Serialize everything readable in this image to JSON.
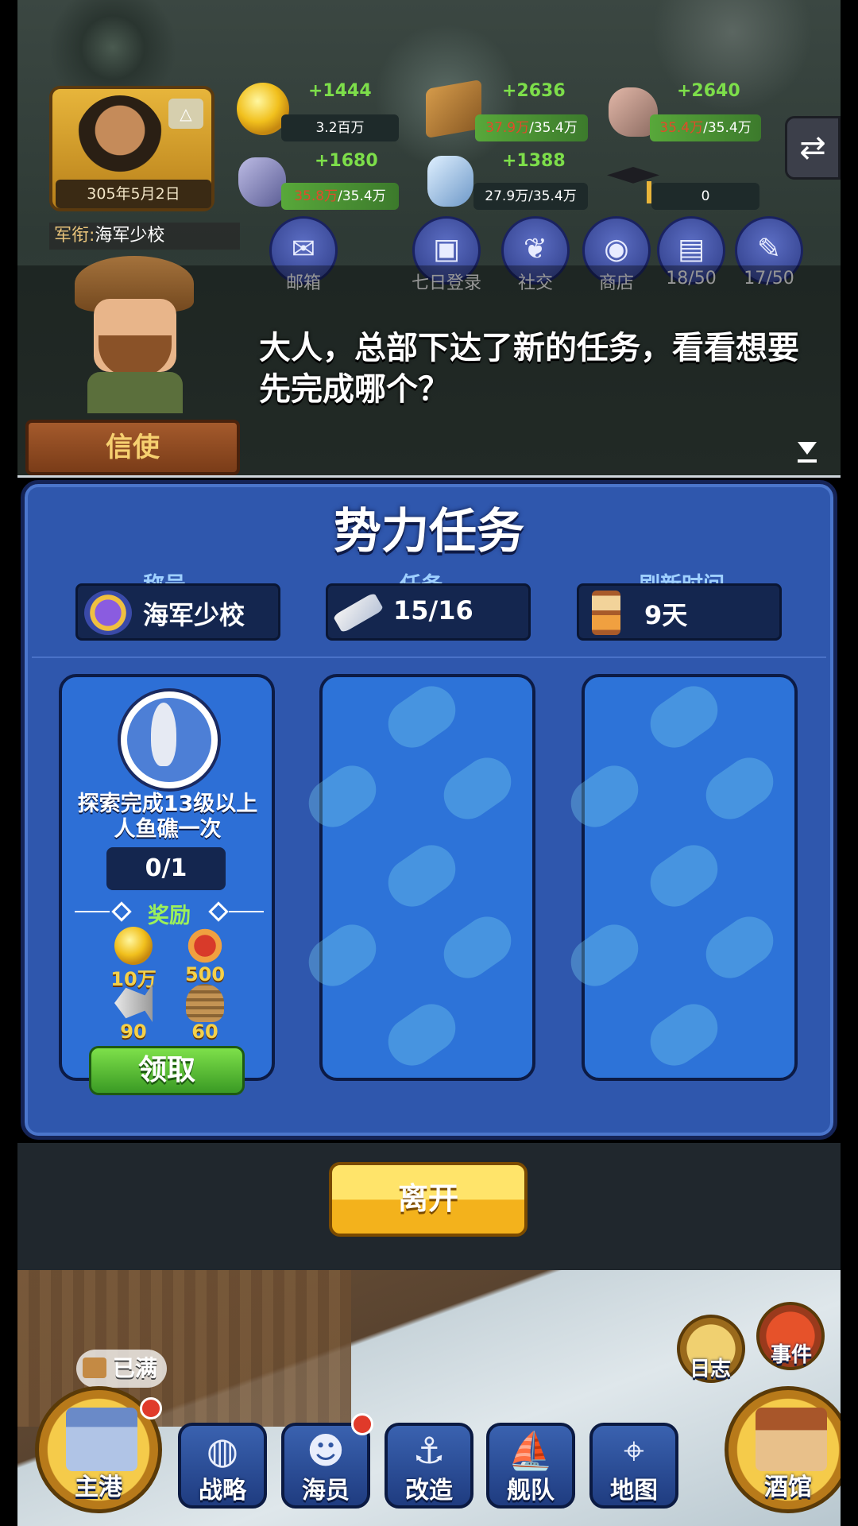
{
  "hud": {
    "date": "305年5月2日",
    "gold": {
      "amount": "3.2百万",
      "gain": "+1444"
    },
    "wood": {
      "current": "37.9万",
      "max": "/35.4万",
      "gain": "+2636"
    },
    "stone": {
      "current": "35.4万",
      "max": "/35.4万",
      "gain": "+2640"
    },
    "iron": {
      "current": "35.8万",
      "max": "/35.4万",
      "gain": "+1680"
    },
    "crystal": {
      "amount": "27.9万/35.4万",
      "gain": "+1388"
    },
    "scholar": {
      "amount": "0"
    },
    "rank_line": {
      "label": "军衔:",
      "value": "海军少校"
    },
    "shortcuts": [
      {
        "icon": "mail-icon",
        "glyph": "✉",
        "label": "邮箱"
      },
      {
        "icon": "calendar-icon",
        "glyph": "▣",
        "label": "七日登录"
      },
      {
        "icon": "laurel-icon",
        "glyph": "❦",
        "label": "社交"
      },
      {
        "icon": "bag-icon",
        "glyph": "◉",
        "label": "商店"
      },
      {
        "icon": "book-icon",
        "glyph": "▤",
        "label": "18/50"
      },
      {
        "icon": "stamp-icon",
        "glyph": "✎",
        "label": "17/50"
      }
    ],
    "swap_glyph": "⇄"
  },
  "dialog": {
    "speech": "大人，总部下达了新的任务，看看想要先完成哪个？",
    "speaker": "信使"
  },
  "panel": {
    "title": "势力任务",
    "stats": [
      {
        "label": "称号",
        "value": "海军少校",
        "icon": "rank-badge-icon"
      },
      {
        "label": "任务",
        "value": "15/16",
        "icon": "scroll-icon"
      },
      {
        "label": "刷新时间",
        "value": "9天",
        "icon": "hourglass-icon"
      }
    ],
    "task": {
      "description": "探索完成13级以上人鱼礁一次",
      "progress": "0/1",
      "reward_label": "奖励",
      "rewards": [
        {
          "icon": "gold-coin-icon",
          "amount": "10万"
        },
        {
          "icon": "medal-icon",
          "amount": "500"
        },
        {
          "icon": "fish-bone-icon",
          "amount": "90"
        },
        {
          "icon": "rope-basket-icon",
          "amount": "60"
        }
      ],
      "claim_label": "领取"
    },
    "leave_label": "离开"
  },
  "bottom_nav": {
    "full_tag": "已满",
    "log_label": "日志",
    "event_label": "事件",
    "items": [
      {
        "label": "主港",
        "glyph": ""
      },
      {
        "label": "战略",
        "glyph": "◍"
      },
      {
        "label": "海员",
        "glyph": "☻"
      },
      {
        "label": "改造",
        "glyph": "⚓"
      },
      {
        "label": "舰队",
        "glyph": "⛵"
      },
      {
        "label": "地图",
        "glyph": "⌖"
      },
      {
        "label": "酒馆",
        "glyph": ""
      }
    ]
  },
  "colors": {
    "panel_blue": "#2f57ad",
    "gain_green": "#7dde4a",
    "overflow_red": "#e34a2a",
    "claim_green": "#3a9a24",
    "leave_yellow": "#f3b21c"
  }
}
